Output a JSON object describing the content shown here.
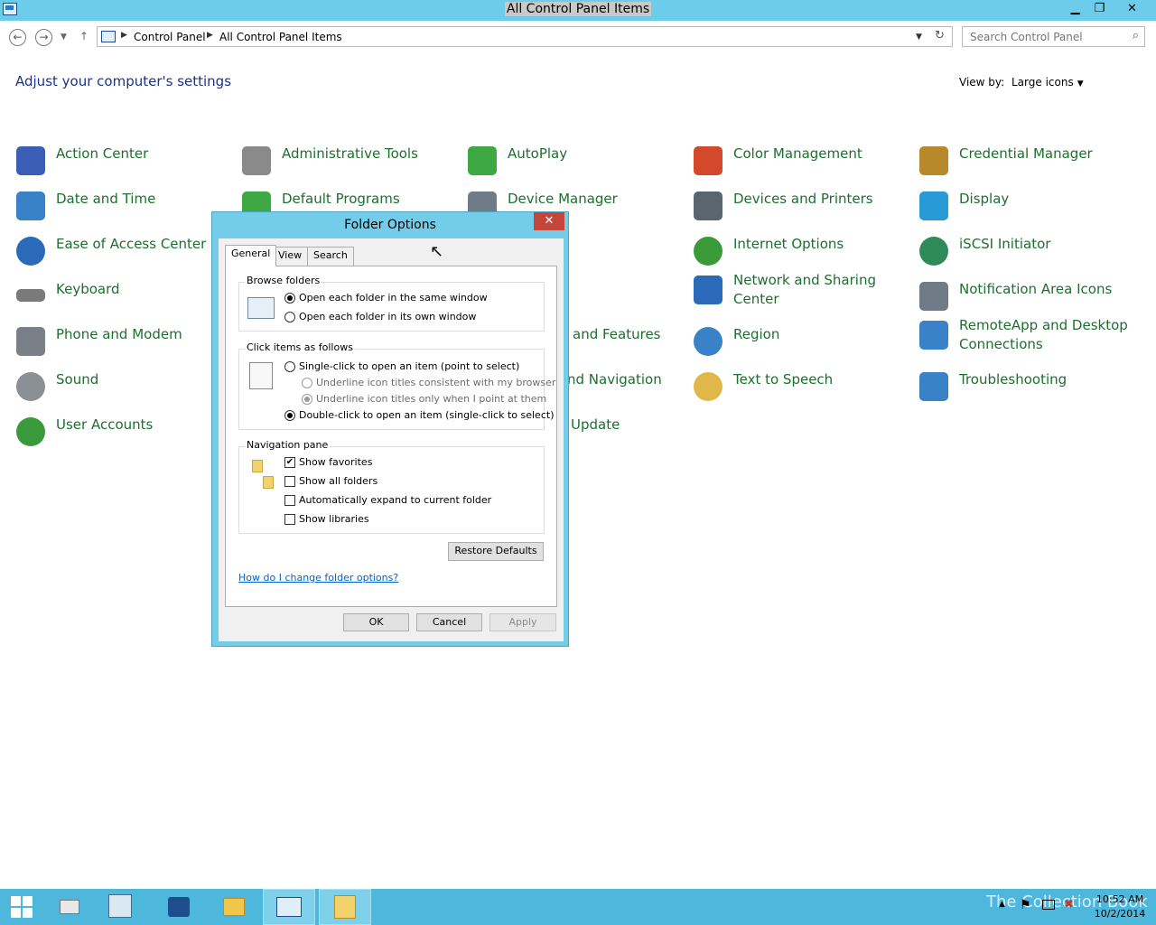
{
  "window": {
    "title": "All Control Panel Items"
  },
  "window_buttons": {
    "minimize": "▁",
    "restore": "❐",
    "close": "✕"
  },
  "address": {
    "breadcrumbs": [
      "Control Panel",
      "All Control Panel Items"
    ],
    "search_placeholder": "Search Control Panel"
  },
  "header": {
    "heading": "Adjust your computer's settings",
    "view_by_label": "View by:",
    "view_by_value": "Large icons"
  },
  "items": [
    {
      "label": "Action Center",
      "icon": "action-center-icon",
      "color": "#3a5fb5"
    },
    {
      "label": "Administrative Tools",
      "icon": "administrative-tools-icon",
      "color": "#8a8a8a"
    },
    {
      "label": "AutoPlay",
      "icon": "autoplay-icon",
      "color": "#3ea842"
    },
    {
      "label": "Color Management",
      "icon": "color-management-icon",
      "color": "#d4492b"
    },
    {
      "label": "Credential Manager",
      "icon": "credential-manager-icon",
      "color": "#b8892b"
    },
    {
      "label": "Date and Time",
      "icon": "date-time-icon",
      "color": "#3a82c8"
    },
    {
      "label": "Default Programs",
      "icon": "default-programs-icon",
      "color": "#3ea842"
    },
    {
      "label": "Device Manager",
      "icon": "device-manager-icon",
      "color": "#6f7b87"
    },
    {
      "label": "Devices and Printers",
      "icon": "devices-printers-icon",
      "color": "#5a6570"
    },
    {
      "label": "Display",
      "icon": "display-icon",
      "color": "#2a9ad6"
    },
    {
      "label": "Ease of Access Center",
      "icon": "ease-of-access-icon",
      "color": "#2a6ab8"
    },
    {
      "label": "Internet Options",
      "icon": "internet-options-icon",
      "color": "#3a9a3a"
    },
    {
      "label": "iSCSI Initiator",
      "icon": "iscsi-initiator-icon",
      "color": "#2f8a5a"
    },
    {
      "label": "Keyboard",
      "icon": "keyboard-icon",
      "color": "#7a7a7a"
    },
    {
      "label": "Network and Sharing Center",
      "icon": "network-sharing-icon",
      "color": "#2a6ab8"
    },
    {
      "label": "Notification Area Icons",
      "icon": "notification-area-icon",
      "color": "#6f7b87"
    },
    {
      "label": "Phone and Modem",
      "icon": "phone-modem-icon",
      "color": "#7a8087"
    },
    {
      "label": "and Features",
      "icon": "programs-features-icon",
      "color": "#4a4a4a"
    },
    {
      "label": "Region",
      "icon": "region-icon",
      "color": "#3a82c8"
    },
    {
      "label": "RemoteApp and Desktop Connections",
      "icon": "remoteapp-icon",
      "color": "#3a82c8"
    },
    {
      "label": "Sound",
      "icon": "sound-icon",
      "color": "#8a9096"
    },
    {
      "label": "nd Navigation",
      "icon": "taskbar-navigation-icon",
      "color": "#4a4a4a"
    },
    {
      "label": "Text to Speech",
      "icon": "text-to-speech-icon",
      "color": "#e0b84a"
    },
    {
      "label": "Troubleshooting",
      "icon": "troubleshooting-icon",
      "color": "#3a82c8"
    },
    {
      "label": "User Accounts",
      "icon": "user-accounts-icon",
      "color": "#3a9a3a"
    },
    {
      "label": "Update",
      "icon": "windows-update-icon",
      "color": "#4a4a4a"
    }
  ],
  "dialog": {
    "title": "Folder Options",
    "close": "✕",
    "tabs": [
      "General",
      "View",
      "Search"
    ],
    "browse_folders": {
      "legend": "Browse folders",
      "options": [
        "Open each folder in the same window",
        "Open each folder in its own window"
      ],
      "selected": 0
    },
    "click_items": {
      "legend": "Click items as follows",
      "single": "Single-click to open an item (point to select)",
      "sub_options": [
        "Underline icon titles consistent with my browser",
        "Underline icon titles only when I point at them"
      ],
      "double": "Double-click to open an item (single-click to select)"
    },
    "navigation_pane": {
      "legend": "Navigation pane",
      "options": [
        "Show favorites",
        "Show all folders",
        "Automatically expand to current folder",
        "Show libraries"
      ],
      "checked": [
        true,
        false,
        false,
        false
      ]
    },
    "restore_defaults": "Restore Defaults",
    "help_link": "How do I change folder options?",
    "buttons": {
      "ok": "OK",
      "cancel": "Cancel",
      "apply": "Apply"
    }
  },
  "taskbar": {
    "watermark": "The Collection Book",
    "time": "10:52 AM",
    "date": "10/2/2014"
  }
}
